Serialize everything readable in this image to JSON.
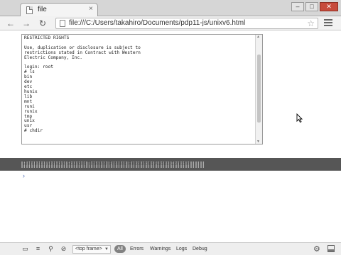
{
  "browser": {
    "tab_title": "file",
    "url": "file:///C:/Users/takahiro/Documents/pdp11-js/unixv6.html",
    "window_controls": {
      "minimize": "–",
      "maximize": "□",
      "close": "✕"
    },
    "nav": {
      "back": "←",
      "forward": "→",
      "reload": "↻",
      "star": "☆",
      "tab_close": "×"
    }
  },
  "terminal": {
    "lines": [
      "RESTRICTED RIGHTS",
      "",
      "Use, duplication or disclosure is subject to",
      "restrictions stated in Contract with Western",
      "Electric Company, Inc.",
      "",
      "login: root",
      "# ls",
      "bin",
      "dev",
      "etc",
      "hunix",
      "lib",
      "mnt",
      "runi",
      "runix",
      "tmp",
      "unix",
      "usr",
      "# chdir"
    ]
  },
  "devtools": {
    "bar_text": "Elements  Network  Sources  Timeline  Profiles  Resources  Audits  Console",
    "console_prompt": "›",
    "footer": {
      "frame_select": "<top frame>",
      "filters": [
        "All",
        "Errors",
        "Warnings",
        "Logs",
        "Debug"
      ]
    }
  },
  "icons": {
    "page": "page-icon",
    "menu": "hamburger-icon",
    "cursor": "mouse-pointer-icon",
    "settings": "gear-icon",
    "dock": "dock-icon"
  },
  "colors": {
    "devtools_bar": "#565656",
    "console_prompt": "#4b6ab5",
    "filter_active": "#828282"
  }
}
